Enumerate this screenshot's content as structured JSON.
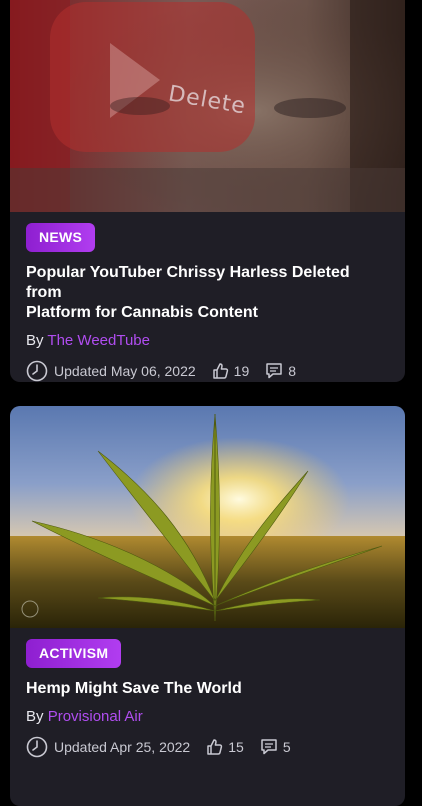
{
  "articles": [
    {
      "category": "NEWS",
      "title_line1": "Popular YouTuber Chrissy Harless Deleted from",
      "title_line2": "Platform for Cannabis Content",
      "by_label": "By",
      "author": "The WeedTube",
      "updated": "Updated May 06, 2022",
      "likes": "19",
      "comments": "8",
      "image_text": "Delete"
    },
    {
      "category": "ACTIVISM",
      "title_line1": "Hemp Might Save The World",
      "by_label": "By",
      "author": "Provisional Air",
      "updated": "Updated Apr 25, 2022",
      "likes": "15",
      "comments": "5"
    }
  ],
  "colors": {
    "accent": "#b04df0",
    "card_bg": "#1f1e26",
    "page_bg": "#000000"
  },
  "icons": {
    "clock": "clock-icon",
    "like": "thumbs-up-icon",
    "comment": "comment-icon"
  }
}
